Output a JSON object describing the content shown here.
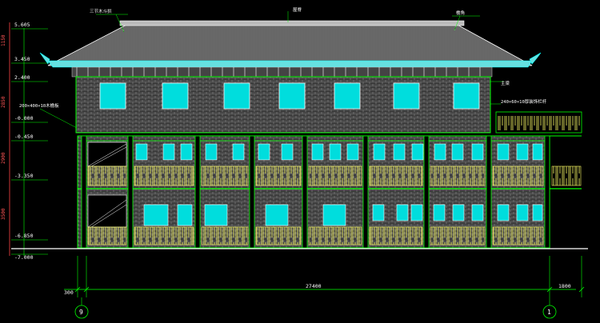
{
  "elevations": [
    {
      "label": "5.605"
    },
    {
      "label": "3.450"
    },
    {
      "label": "2.400"
    },
    {
      "label": "-0.000"
    },
    {
      "label": "-0.450"
    },
    {
      "label": "-3.350"
    },
    {
      "label": "-6.850"
    },
    {
      "label": "-7.000"
    }
  ],
  "vertical_dims": [
    "1150",
    "2850",
    "2900",
    "3500"
  ],
  "annotations": {
    "top_left": "三节木斗拱",
    "ridge": "屋脊",
    "top_right": "檐角",
    "right_beam": "主梁",
    "right_railing": "240×60×10厚装饰栏杆",
    "left_beam": "200×400×10木檐板"
  },
  "dimensions": {
    "left": "300",
    "middle": "27400",
    "right": "1800"
  },
  "axes": {
    "left": "9",
    "right": "1"
  },
  "colors": {
    "background": "#000000",
    "line_green": "#00ff00",
    "wall_gray": "#8a8a8a",
    "window_cyan": "#00ffff",
    "railing_yellow": "#ffff66",
    "roof_white": "#dcdcdc",
    "roof_cyan": "#66e0e0",
    "text": "#ffffff"
  }
}
